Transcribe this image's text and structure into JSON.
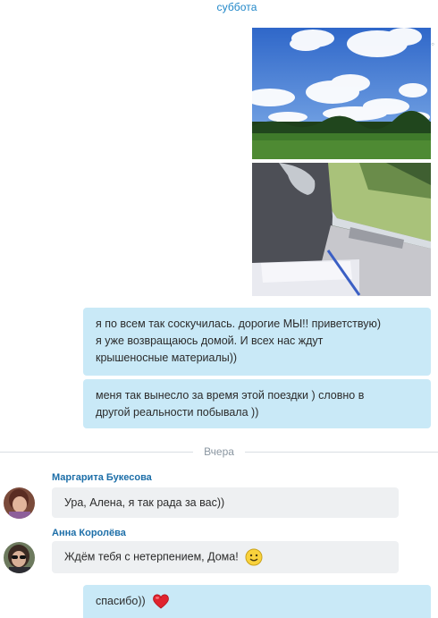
{
  "timeline": {
    "top_day": "суббота",
    "divider_label": "Вчера"
  },
  "outgoing": {
    "message_1": {
      "line_1": "я по всем так соскучилась. дорогие МЫ!! приветствую)",
      "line_2": "я уже возвращаюсь домой. И всех нас ждут",
      "line_3": "крышеносные материалы))"
    },
    "message_2": {
      "line_1": "меня так вынесло за время этой поездки ) словно в",
      "line_2": "другой реальности побывала ))"
    },
    "message_3": {
      "text": "спасибо))"
    }
  },
  "incoming": [
    {
      "sender": "Маргарита Букесова",
      "text": "Ура, Алена, я так рада за вас))"
    },
    {
      "sender": "Анна Королёва",
      "text": "Ждём тебя с нетерпением, Дома!"
    }
  ],
  "colors": {
    "outgoing_bubble": "#c9e9f7",
    "incoming_bubble": "#eef0f2",
    "sender_name": "#1c6ea8",
    "day_label": "#1f86c8"
  },
  "icons": {
    "smile": "smile-emoji-icon",
    "heart": "heart-emoji-icon"
  }
}
